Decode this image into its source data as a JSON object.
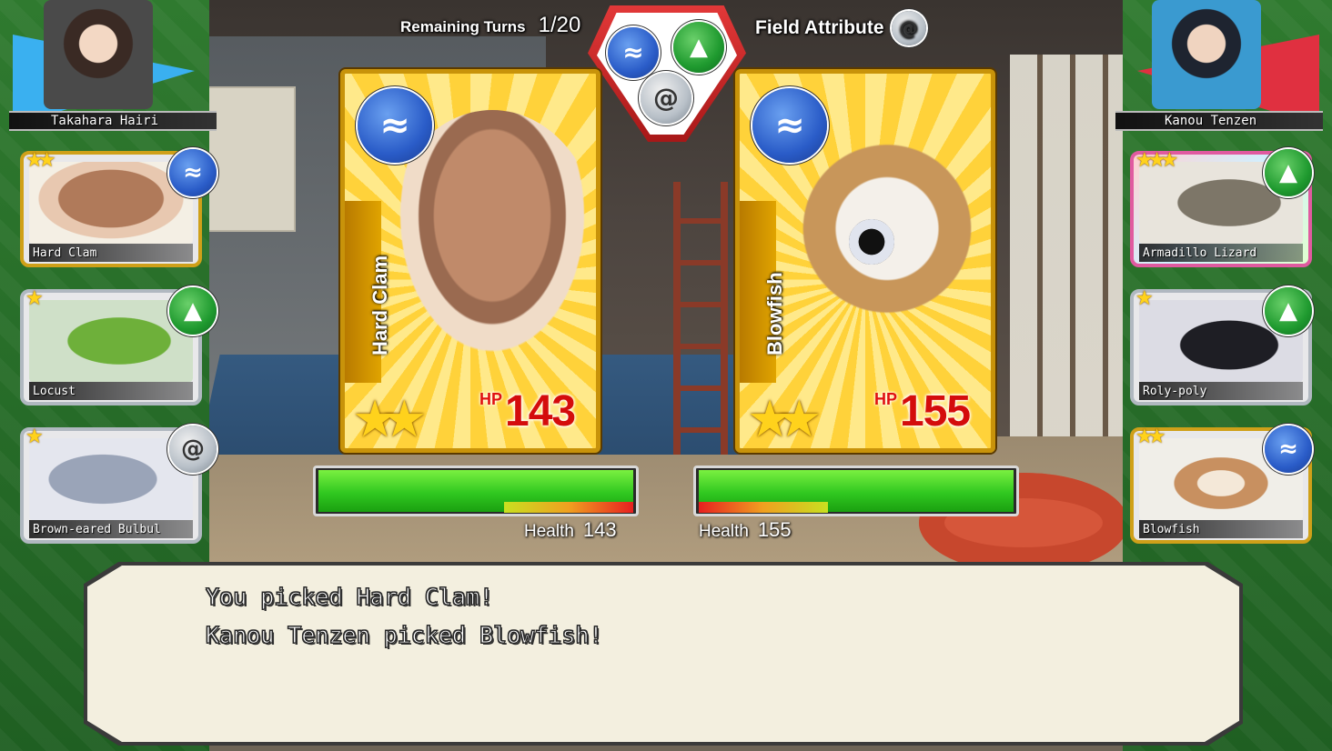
{
  "hud": {
    "remaining_turns_label": "Remaining Turns",
    "remaining_turns_value": "1/20",
    "field_attribute_label": "Field Attribute",
    "field_attribute_icon": "wind-icon"
  },
  "attribute_cycle": {
    "icons": [
      "water-icon",
      "earth-icon",
      "wind-icon"
    ]
  },
  "players": {
    "left": {
      "name": "Takahara Hairi"
    },
    "right": {
      "name": "Kanou Tenzen"
    }
  },
  "left_roster": [
    {
      "name": "Hard Clam",
      "stars": "★★",
      "attribute": "water-icon"
    },
    {
      "name": "Locust",
      "stars": "★",
      "attribute": "earth-icon"
    },
    {
      "name": "Brown-eared Bulbul",
      "stars": "★",
      "attribute": "wind-icon"
    }
  ],
  "right_roster": [
    {
      "name": "Armadillo Lizard",
      "stars": "★★★",
      "attribute": "earth-icon"
    },
    {
      "name": "Roly-poly",
      "stars": "★",
      "attribute": "earth-icon"
    },
    {
      "name": "Blowfish",
      "stars": "★★",
      "attribute": "water-icon"
    }
  ],
  "battle": {
    "left_card": {
      "name": "Hard Clam",
      "stars": "★★",
      "hp_label": "HP",
      "hp": "143",
      "attribute": "water-icon"
    },
    "right_card": {
      "name": "Blowfish",
      "stars": "★★",
      "hp_label": "HP",
      "hp": "155",
      "attribute": "water-icon"
    }
  },
  "health": {
    "left": {
      "label": "Health",
      "value": "143",
      "fraction": 1.0
    },
    "right": {
      "label": "Health",
      "value": "155",
      "fraction": 1.0
    }
  },
  "dialogue": {
    "lines": [
      "You picked Hard Clam!",
      "Kanou Tenzen picked Blowfish!"
    ]
  },
  "colors": {
    "water": "#2a5cc8",
    "earth": "#1f9a2f",
    "wind": "#b8c0c8",
    "hp_red": "#d40c0c",
    "card_gold": "#c8930a"
  }
}
